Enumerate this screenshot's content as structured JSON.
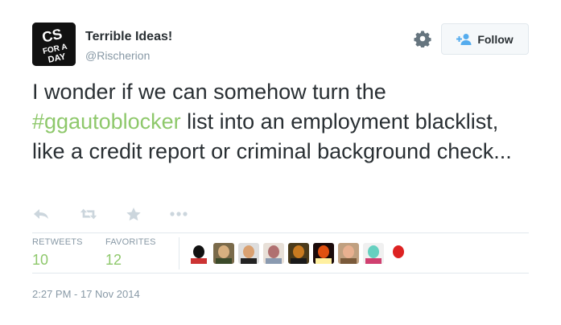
{
  "author": {
    "name": "Terrible Ideas!",
    "handle": "@Rischerion",
    "avatar_text": "CS FOR A DAY"
  },
  "follow_label": "Follow",
  "tweet": {
    "before": "I wonder if we can somehow turn the ",
    "hashtag": "#ggautoblocker",
    "after": " list into an employment blacklist, like a credit report or criminal background check..."
  },
  "actions": [
    "reply-icon",
    "retweet-icon",
    "favorite-icon",
    "more-icon"
  ],
  "stats": {
    "retweets_label": "RETWEETS",
    "retweets": "10",
    "favorites_label": "FAVORITES",
    "favorites": "12"
  },
  "favoriter_avatars": [
    {
      "colors": [
        "#ffffff",
        "#111111",
        "#cc3333"
      ]
    },
    {
      "colors": [
        "#7a6a4a",
        "#d8b080",
        "#3b4a2a"
      ]
    },
    {
      "colors": [
        "#dddddd",
        "#d9a070",
        "#222222"
      ]
    },
    {
      "colors": [
        "#e8e0d8",
        "#b07070",
        "#8a9ab0"
      ]
    },
    {
      "colors": [
        "#4a3a1a",
        "#c87a20",
        "#1a1a1a"
      ]
    },
    {
      "colors": [
        "#1a0a0a",
        "#e05010",
        "#fff0a0"
      ]
    },
    {
      "colors": [
        "#c0a080",
        "#e8b090",
        "#7a5a3a"
      ]
    },
    {
      "colors": [
        "#f0f0f0",
        "#66d0c0",
        "#d04070"
      ]
    },
    {
      "colors": [
        "#ffffff",
        "#dd2222",
        "#ffffff"
      ]
    }
  ],
  "colors": {
    "hashtag": "#8ec86b",
    "stat_number": "#8ec86b",
    "muted": "#8899a6",
    "follow_icon": "#55acee"
  },
  "timestamp": "2:27 PM - 17 Nov 2014"
}
